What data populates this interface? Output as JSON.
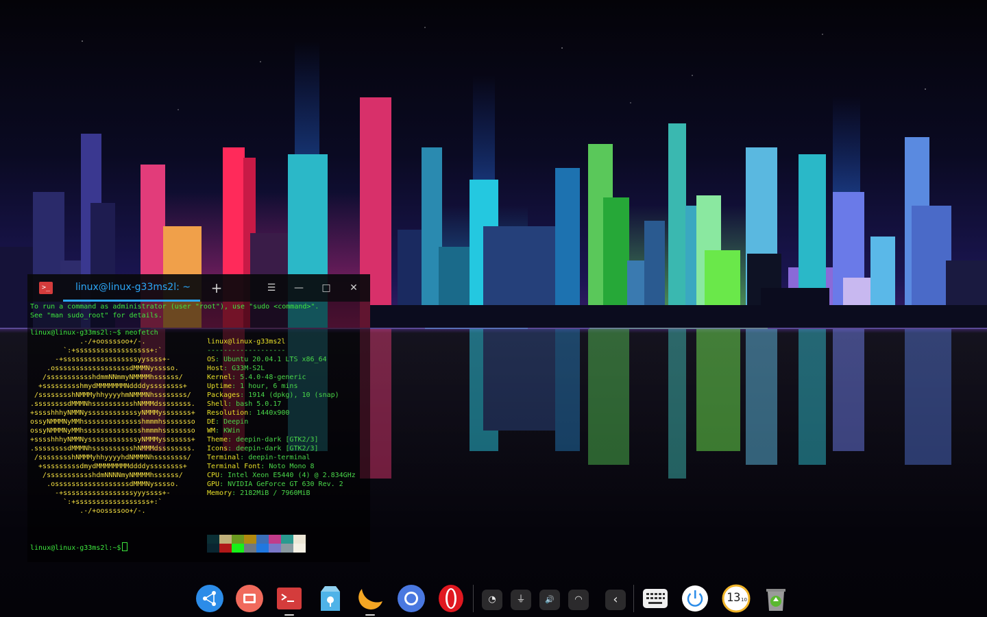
{
  "window": {
    "tab_label": "linux@linux-g33ms2l: ~",
    "new_tab_symbol": "+",
    "menu_symbol": "☰",
    "minimize_symbol": "—",
    "maximize_symbol": "□",
    "close_symbol": "✕",
    "app_icon_glyph": ">_"
  },
  "terminal": {
    "motd": [
      "To run a command as administrator (user \"root\"), use \"sudo <command>\".",
      "See \"man sudo_root\" for details."
    ],
    "prompt": "linux@linux-g33ms2l:~$",
    "command": " neofetch",
    "final_prompt": "linux@linux-g33ms2l:~$",
    "logo": [
      "            .-/+oossssoo+/-.",
      "        `:+ssssssssssssssssss+:`",
      "      -+ssssssssssssssssssyyssss+-",
      "    .ossssssssssssssssssdMMMNysssso.",
      "   /ssssssssssshdmmNNmmyNMMMMhssssss/",
      "  +ssssssssshmydMMMMMMMNddddyssssssss+",
      " /sssssssshNMMMyhhyyyyhmNMMMNhssssssss/",
      ".ssssssssdMMMNhsssssssssshNMMMdssssssss.",
      "+sssshhhyNMMNyssssssssssssyNMMMysssssss+",
      "ossyNMMMNyMMhsssssssssssssshmmmhssssssso",
      "ossyNMMMNyMMhsssssssssssssshmmmhssssssso",
      "+sssshhhyNMMNyssssssssssssyNMMMysssssss+",
      ".ssssssssdMMMNhsssssssssshNMMMdssssssss.",
      " /sssssssshNMMMyhhyyyyhdNMMMNhssssssss/",
      "  +sssssssssdmydMMMMMMMMddddyssssssss+",
      "   /ssssssssssshdmNNNNmyNMMMMhssssss/",
      "    .ossssssssssssssssssdMMMNysssso.",
      "      -+sssssssssssssssssyyyssss+-",
      "        `:+ssssssssssssssssss+:`",
      "            .-/+oossssoo+/-."
    ],
    "user_host": "linux@linux-g33ms2l",
    "separator": "-------------------",
    "info": [
      {
        "key": "OS",
        "value": "Ubuntu 20.04.1 LTS x86_64"
      },
      {
        "key": "Host",
        "value": "G33M-S2L"
      },
      {
        "key": "Kernel",
        "value": "5.4.0-48-generic"
      },
      {
        "key": "Uptime",
        "value": "1 hour, 6 mins"
      },
      {
        "key": "Packages",
        "value": "1914 (dpkg), 10 (snap)"
      },
      {
        "key": "Shell",
        "value": "bash 5.0.17"
      },
      {
        "key": "Resolution",
        "value": "1440x900"
      },
      {
        "key": "DE",
        "value": "Deepin"
      },
      {
        "key": "WM",
        "value": "KWin"
      },
      {
        "key": "Theme",
        "value": "deepin-dark [GTK2/3]"
      },
      {
        "key": "Icons",
        "value": "deepin-dark [GTK2/3]"
      },
      {
        "key": "Terminal",
        "value": "deepin-terminal"
      },
      {
        "key": "Terminal Font",
        "value": "Noto Mono 8"
      },
      {
        "key": "CPU",
        "value": "Intel Xeon E5440 (4) @ 2.834GHz"
      },
      {
        "key": "GPU",
        "value": "NVIDIA GeForce GT 630 Rev. 2"
      },
      {
        "key": "Memory",
        "value": "2182MiB / 7960MiB"
      }
    ],
    "palette_top": [
      "#0b2f35",
      "#c0b07a",
      "#6b9a20",
      "#b28a10",
      "#3b6fb8",
      "#c23c8a",
      "#2a9a90",
      "#ece6d6"
    ],
    "palette_bottom": [
      "#0a2530",
      "#b01818",
      "#18f018",
      "#707880",
      "#2078e0",
      "#7a78c8",
      "#8a9aa0",
      "#f4f0e4"
    ]
  },
  "dock": {
    "apps": [
      {
        "name": "launcher-icon",
        "color": "#2c8ce8"
      },
      {
        "name": "screen-recorder-icon",
        "color": "#f06a5c"
      },
      {
        "name": "terminal-icon",
        "color": "#d43c3c"
      },
      {
        "name": "app-store-icon",
        "color": "#4fb3e8"
      },
      {
        "name": "music-player-icon",
        "color": "#f5a623"
      },
      {
        "name": "chromium-icon",
        "color": "#4a78e0"
      },
      {
        "name": "opera-icon",
        "color": "#e01820"
      }
    ],
    "tray": [
      {
        "name": "clock-widget-icon",
        "glyph": "◔"
      },
      {
        "name": "usb-icon",
        "glyph": "⏚"
      },
      {
        "name": "volume-icon",
        "glyph": "🔊"
      },
      {
        "name": "wifi-icon",
        "glyph": "◠"
      },
      {
        "name": "collapse-tray-icon",
        "glyph": "‹"
      }
    ],
    "clock_text": "13",
    "clock_sub": "10",
    "accent": "#2ca7f8"
  }
}
